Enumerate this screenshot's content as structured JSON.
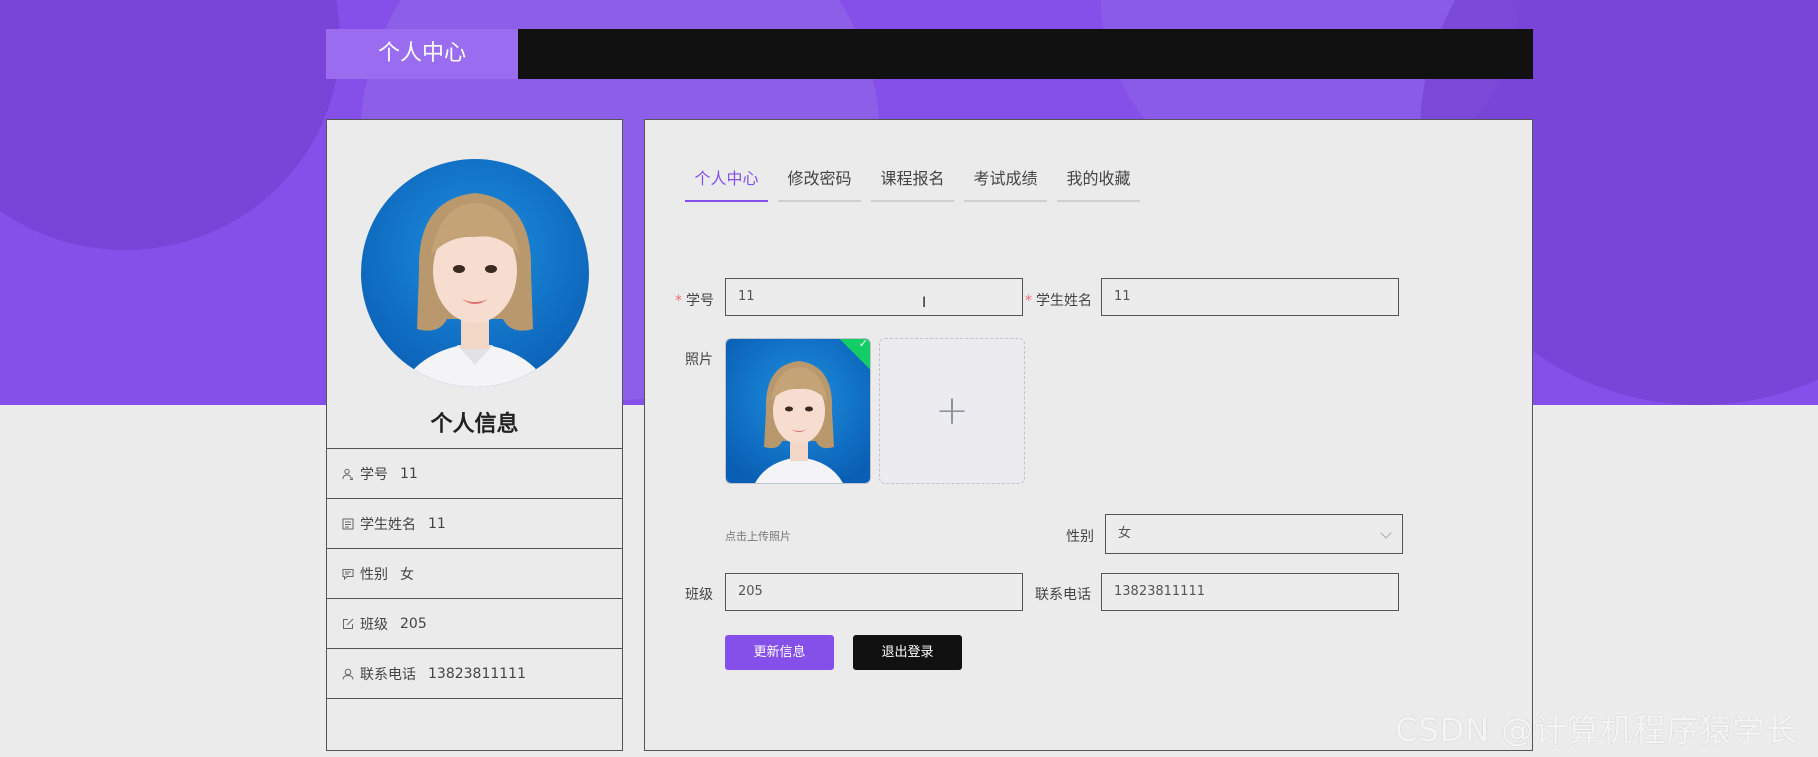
{
  "header": {
    "title": "个人中心"
  },
  "profile": {
    "title": "个人信息",
    "items": [
      {
        "icon": "user-id-icon",
        "label": "学号",
        "value": "11"
      },
      {
        "icon": "name-card-icon",
        "label": "学生姓名",
        "value": "11"
      },
      {
        "icon": "chat-icon",
        "label": "性别",
        "value": "女"
      },
      {
        "icon": "edit-icon",
        "label": "班级",
        "value": "205"
      },
      {
        "icon": "user-icon",
        "label": "联系电话",
        "value": "13823811111"
      }
    ]
  },
  "tabs": [
    {
      "label": "个人中心",
      "active": true
    },
    {
      "label": "修改密码",
      "active": false
    },
    {
      "label": "课程报名",
      "active": false
    },
    {
      "label": "考试成绩",
      "active": false
    },
    {
      "label": "我的收藏",
      "active": false
    }
  ],
  "form": {
    "student_id": {
      "label": "学号",
      "value": "11",
      "required": true
    },
    "student_name": {
      "label": "学生姓名",
      "value": "11",
      "required": true
    },
    "photo": {
      "label": "照片",
      "hint": "点击上传照片",
      "add_symbol": "+"
    },
    "gender": {
      "label": "性别",
      "value": "女"
    },
    "class": {
      "label": "班级",
      "value": "205"
    },
    "phone": {
      "label": "联系电话",
      "value": "13823811111"
    }
  },
  "buttons": {
    "update": "更新信息",
    "logout": "退出登录"
  },
  "watermark": "CSDN @计算机程序猿学长",
  "colors": {
    "accent": "#8550ea",
    "dark": "#111111",
    "success": "#13ce66"
  }
}
